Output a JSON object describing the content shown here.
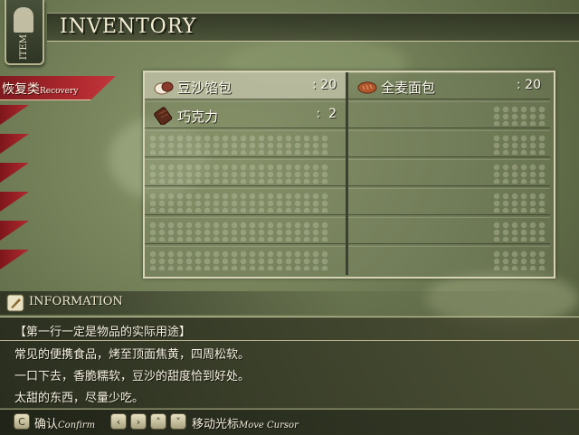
{
  "header": {
    "title": "INVENTORY",
    "side_tag": "ITEM"
  },
  "categories": {
    "active_label": "恢复类",
    "active_label_en": "Recovery",
    "other_tab_count": 6
  },
  "items": [
    {
      "name": "豆沙馅包",
      "qty": ": 20",
      "icon": "bun-icon",
      "selected": true
    },
    {
      "name": "全麦面包",
      "qty": ": 20",
      "icon": "bread-icon",
      "selected": false
    },
    {
      "name": "巧克力",
      "qty": ":  2",
      "icon": "chocolate-icon",
      "selected": false
    }
  ],
  "information": {
    "title": "INFORMATION",
    "heading": "【第一行一定是物品的实际用途】",
    "lines": [
      "常见的便携食品，烤至顶面焦黄，四周松软。",
      "一口下去，香脆糯软，豆沙的甜度恰到好处。",
      "太甜的东西，尽量少吃。"
    ]
  },
  "footer": {
    "confirm_key": "C",
    "confirm_label": "确认",
    "confirm_label_en": "Confirm",
    "move_label": "移动光标",
    "move_label_en": "Move Cursor"
  },
  "colors": {
    "tab_red": "#b32a30",
    "panel_border": "#d6d3b4",
    "text_light": "#fdfaf0"
  }
}
